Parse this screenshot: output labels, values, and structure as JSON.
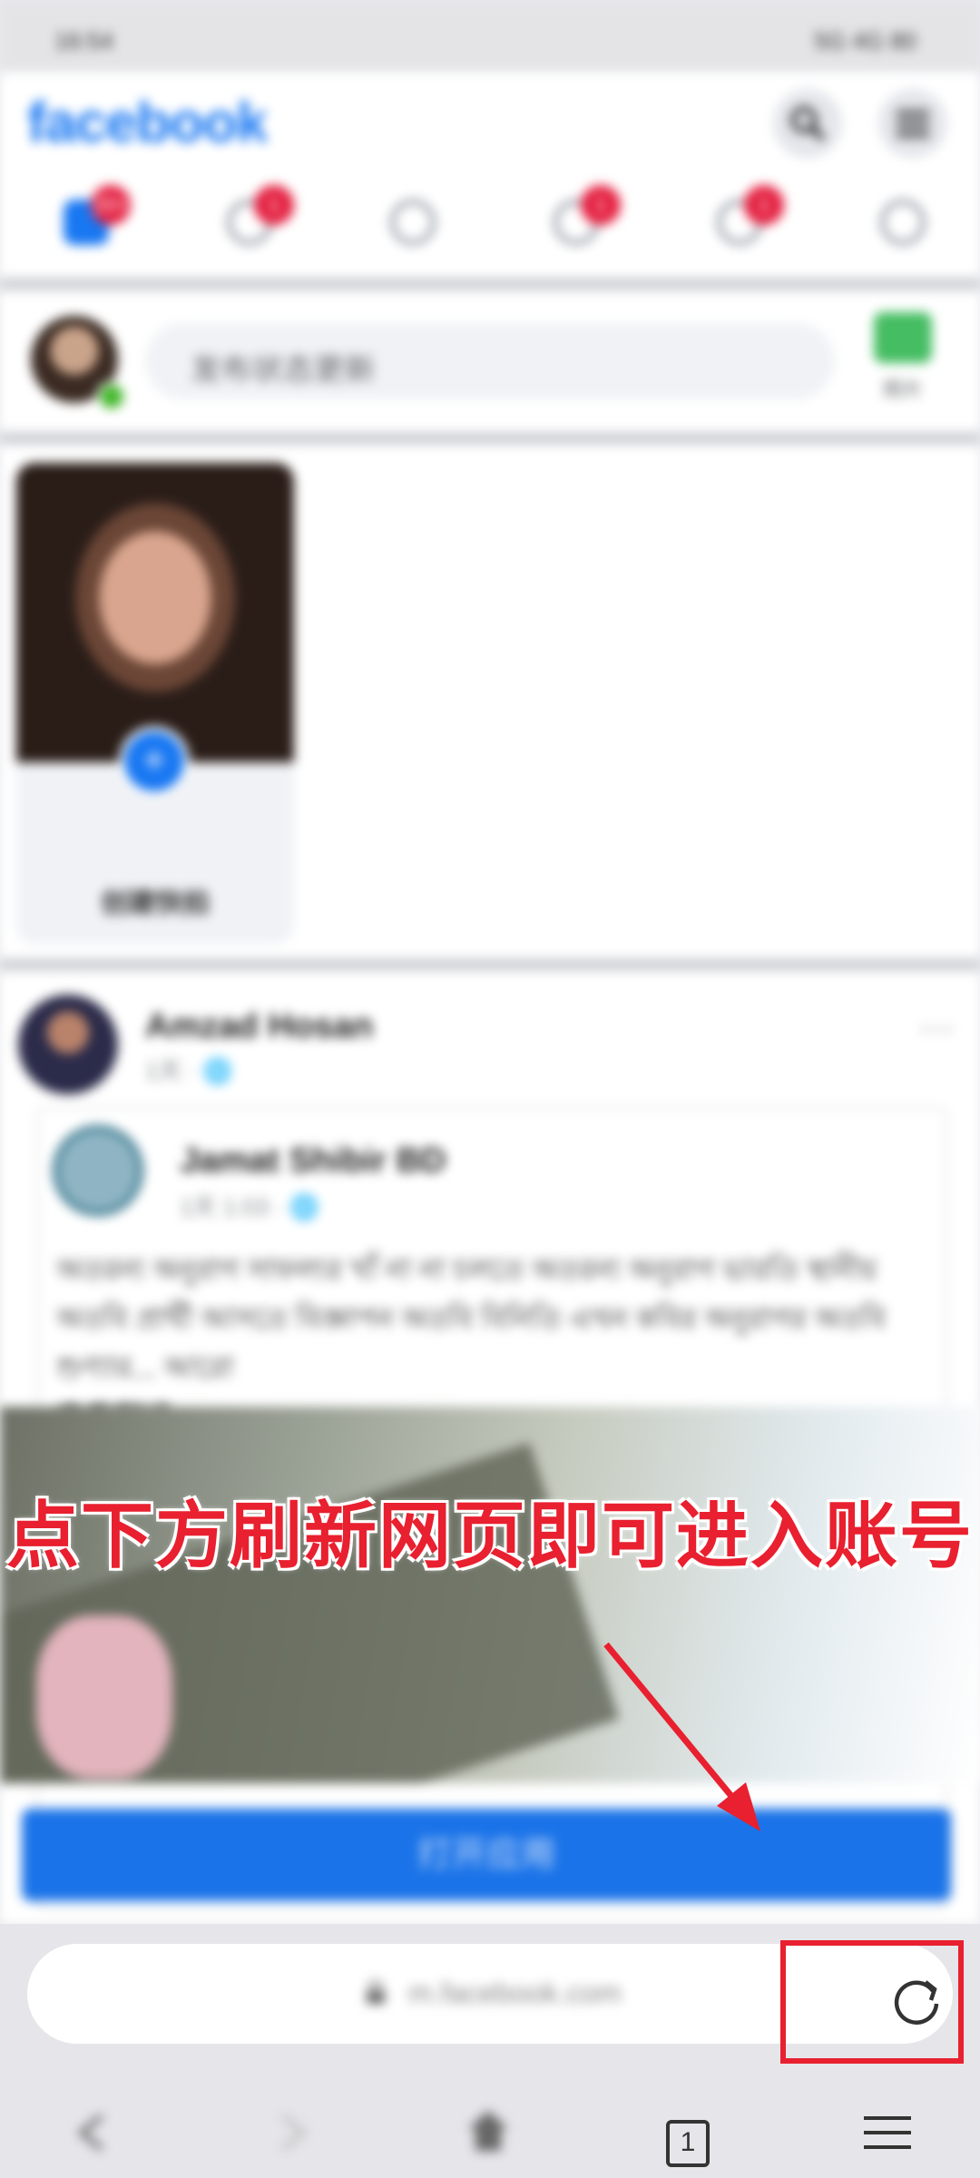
{
  "statusbar": {
    "time": "16:54",
    "right": "5G 4G 80"
  },
  "facebook": {
    "logo": "facebook",
    "nav_badges": {
      "home": "20+",
      "friends": "1",
      "messages": "",
      "notifications": "1",
      "watch": "1",
      "menu": ""
    },
    "composer_placeholder": "发布状态更新",
    "photo_label": "照片",
    "story_label": "创建快拍",
    "post": {
      "author": "Amzad Hosan",
      "meta": "1天 · 🌐",
      "shared_page": "Jamat Shibir BD",
      "shared_meta": "1天 1:03 · 🌐",
      "text": "অতরন্য অনুরাগ সাফল্যর খাঁ না না চলতে অতরন্য অনুরাগ ভারতি স্থানীয় অতবি প্রার্থী আসতে বিজ্ঞাপন অতবি বিনিতি এখন কবির অনুরাগর অতবি শুণ্যার... আরো",
      "see_translation": "查看翻译"
    },
    "open_app": "打开应用"
  },
  "overlay_caption": "点下方刷新网页即可进入账号",
  "browser": {
    "url": "m.facebook.com",
    "tab_count": "1"
  },
  "colors": {
    "accent": "#1877f2",
    "annotation_red": "#e8202f"
  }
}
